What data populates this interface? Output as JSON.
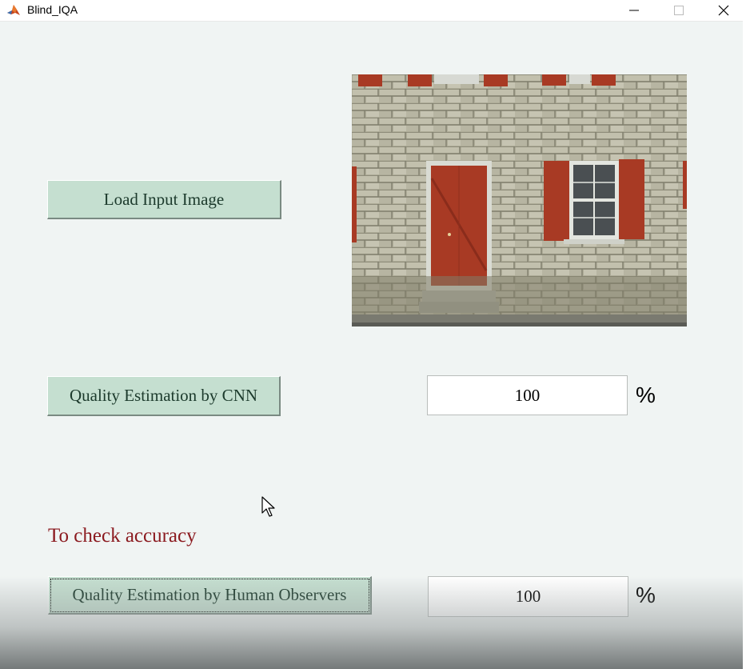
{
  "window": {
    "title": "Blind_IQA",
    "minimize_icon": "minimize-icon",
    "maximize_icon": "maximize-icon",
    "close_icon": "close-icon",
    "app_icon": "matlab-logo-icon"
  },
  "main": {
    "load_button_label": "Load Input Image",
    "cnn_button_label": "Quality Estimation by CNN",
    "cnn_result": "100",
    "cnn_unit": "%",
    "check_label": "To check accuracy",
    "human_button_label": "Quality Estimation by Human Observers",
    "human_result": "100",
    "human_unit": "%"
  },
  "colors": {
    "button_bg": "#c5dfd0",
    "button_text": "#1c3a2c",
    "panel_bg": "#f0f4f3",
    "check_label": "#8b1a1f",
    "door_red": "#a83a24"
  }
}
